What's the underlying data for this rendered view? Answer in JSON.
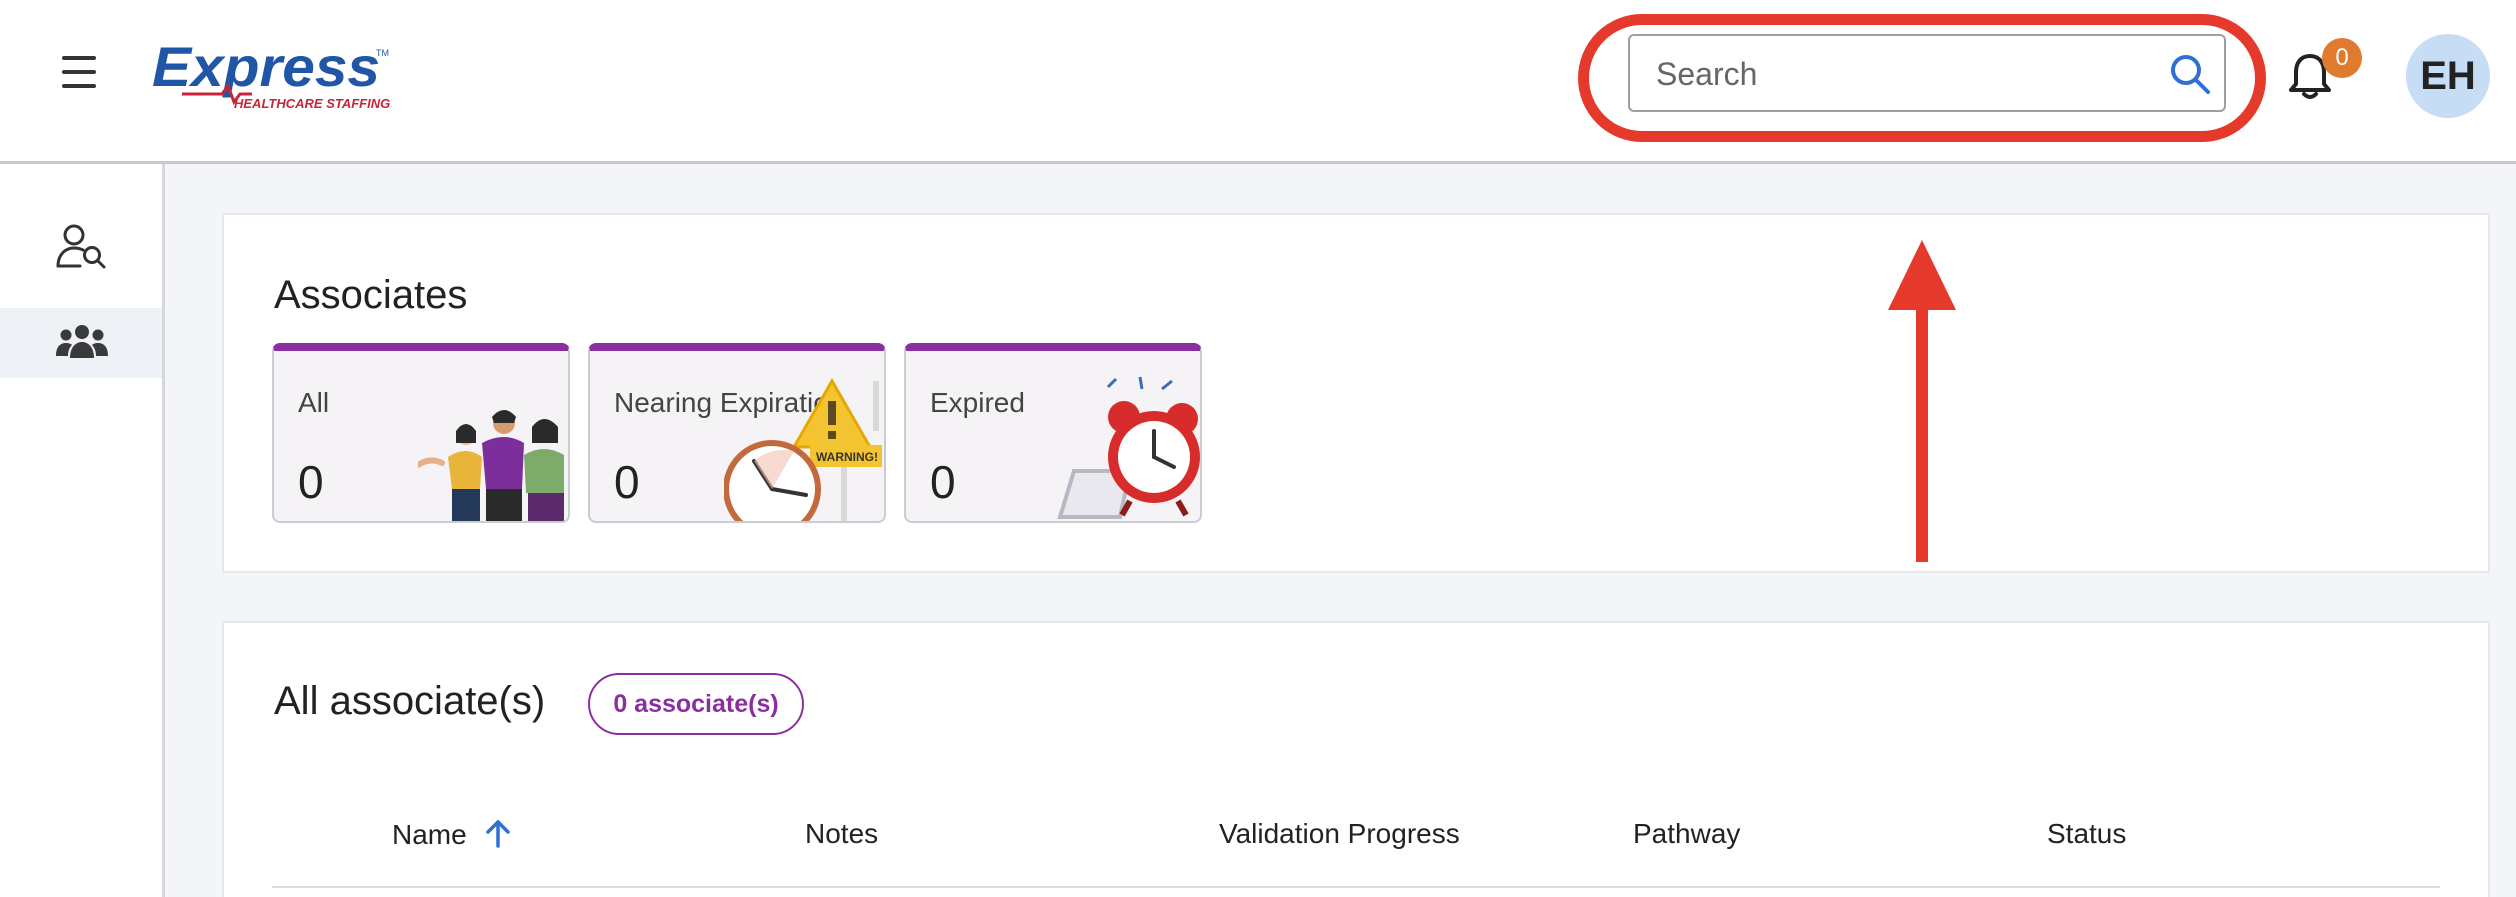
{
  "header": {
    "logo_text": "Express",
    "logo_tagline": "HEALTHCARE STAFFING",
    "search_placeholder": "Search",
    "notification_count": "0",
    "user_initials": "EH"
  },
  "sidebar": {
    "items": [
      {
        "icon": "user-search-icon"
      },
      {
        "icon": "group-icon",
        "active": true
      }
    ]
  },
  "associates": {
    "title": "Associates",
    "tiles": [
      {
        "label": "All",
        "count": "0"
      },
      {
        "label": "Nearing Expiration",
        "count": "0",
        "badge": "WARNING!"
      },
      {
        "label": "Expired",
        "count": "0"
      }
    ]
  },
  "all_associates": {
    "title": "All associate(s)",
    "count_chip": "0 associate(s)",
    "columns": [
      "Name",
      "Notes",
      "Validation Progress",
      "Pathway",
      "Status"
    ],
    "sort": {
      "column": "Name",
      "direction": "ascending"
    }
  },
  "colors": {
    "accent_purple": "#8b2fa0",
    "highlight_red": "#e53a2b",
    "badge_orange": "#e07a2f",
    "link_blue": "#2f6fd6",
    "avatar_bg": "#c7dcf5"
  }
}
